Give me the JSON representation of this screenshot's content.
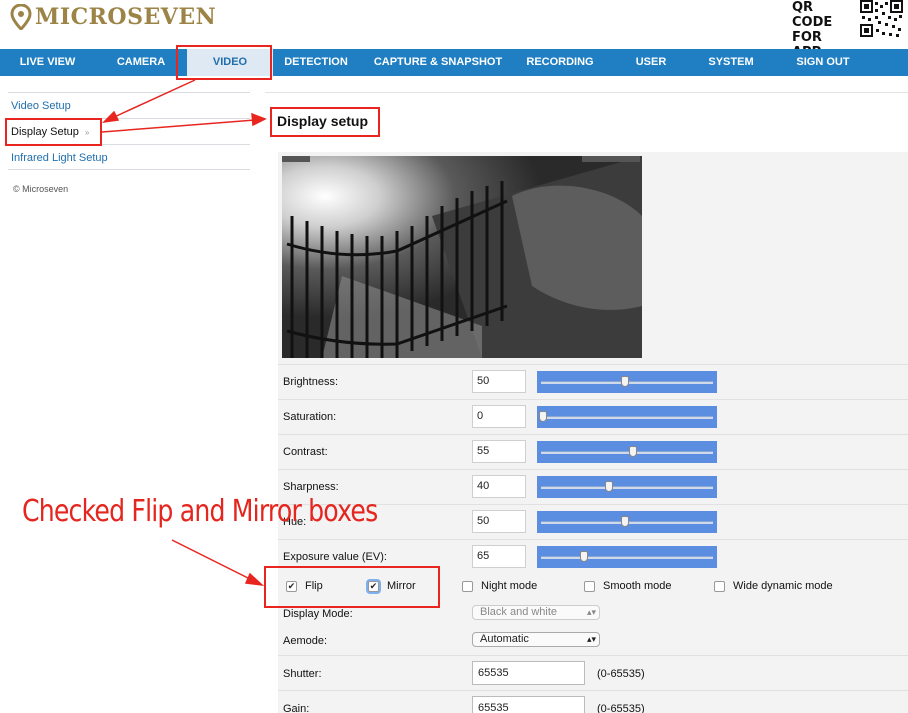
{
  "brand": {
    "name": "MICROSEVEN",
    "logo_color": "#9c8447"
  },
  "qr": {
    "label_line1": "QR CODE",
    "label_line2": "FOR APP"
  },
  "nav": {
    "items": [
      {
        "label": "LIVE VIEW"
      },
      {
        "label": "CAMERA"
      },
      {
        "label": "VIDEO",
        "active": true
      },
      {
        "label": "DETECTION"
      },
      {
        "label": "CAPTURE & SNAPSHOT"
      },
      {
        "label": "RECORDING"
      },
      {
        "label": "USER"
      },
      {
        "label": "SYSTEM"
      },
      {
        "label": "SIGN OUT"
      }
    ],
    "color": "#1f7fc2"
  },
  "sidebar": {
    "items": [
      {
        "label": "Video Setup"
      },
      {
        "label": "Display Setup",
        "active": true
      },
      {
        "label": "Infrared Light Setup"
      }
    ],
    "copyright": "© Microseven"
  },
  "page": {
    "title": "Display setup"
  },
  "sliders": [
    {
      "label": "Brightness:",
      "value": "50",
      "fraction": 0.5
    },
    {
      "label": "Saturation:",
      "value": "0",
      "fraction": 0.0
    },
    {
      "label": "Contrast:",
      "value": "55",
      "fraction": 0.55
    },
    {
      "label": "Sharpness:",
      "value": "40",
      "fraction": 0.4
    },
    {
      "label": "Hue:",
      "value": "50",
      "fraction": 0.5
    },
    {
      "label": "Exposure value (EV):",
      "value": "65",
      "fraction": 0.25
    }
  ],
  "checkboxes": [
    {
      "label": "Flip",
      "checked": true
    },
    {
      "label": "Mirror",
      "checked": true
    },
    {
      "label": "Night mode",
      "checked": false
    },
    {
      "label": "Smooth mode",
      "checked": false
    },
    {
      "label": "Wide dynamic mode",
      "checked": false
    }
  ],
  "display_mode": {
    "label": "Display Mode:",
    "value": "Black and white"
  },
  "aemode": {
    "label": "Aemode:",
    "value": "Automatic"
  },
  "shutter": {
    "label": "Shutter:",
    "value": "65535",
    "range": "(0-65535)"
  },
  "gain": {
    "label": "Gain:",
    "value": "65535",
    "range": "(0-65535)"
  },
  "annotation": {
    "text": "Checked Flip and Mirror boxes",
    "color": "#e5261f"
  }
}
